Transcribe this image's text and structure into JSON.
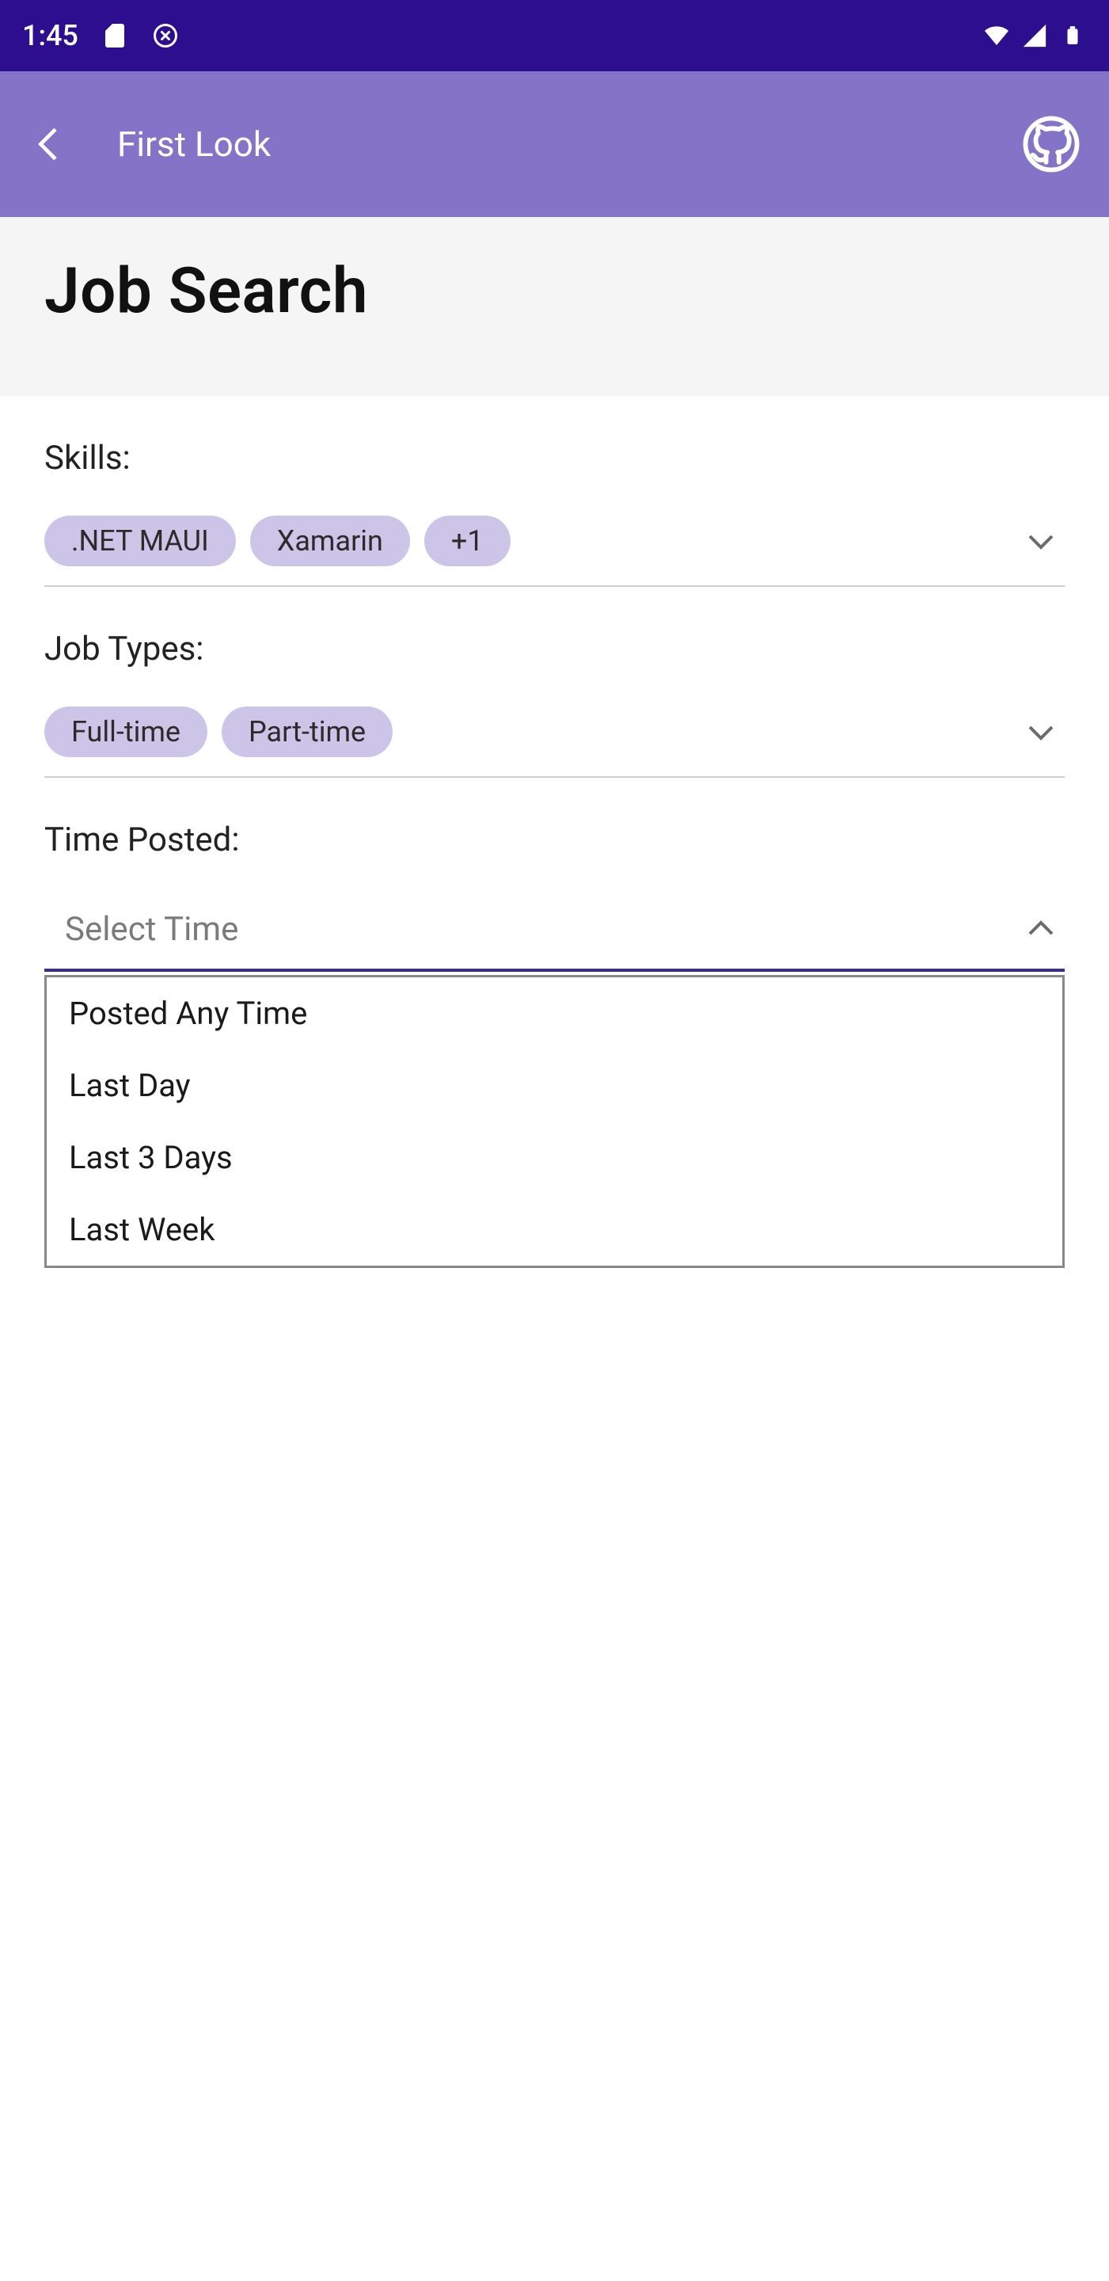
{
  "statusbar": {
    "time": "1:45",
    "icons": {
      "sd": "sd-card-icon",
      "debug": "debug-icon",
      "wifi": "wifi-icon",
      "cell": "cell-signal-icon",
      "battery": "battery-icon"
    }
  },
  "appbar": {
    "title": "First Look"
  },
  "page": {
    "title": "Job Search"
  },
  "skills": {
    "label": "Skills:",
    "chips": [
      ".NET MAUI",
      "Xamarin",
      "+1"
    ]
  },
  "jobtypes": {
    "label": "Job Types:",
    "chips": [
      "Full-time",
      "Part-time"
    ]
  },
  "timeposted": {
    "label": "Time Posted:",
    "placeholder": "Select Time",
    "options": [
      "Posted Any Time",
      "Last Day",
      "Last 3 Days",
      "Last Week"
    ]
  }
}
